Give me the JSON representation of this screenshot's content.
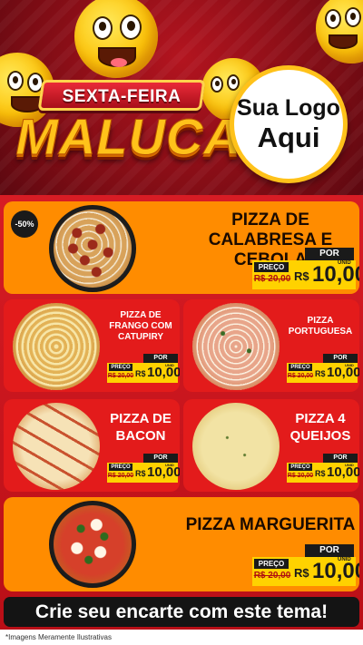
{
  "header": {
    "title_top": "SEXTA-FEIRA",
    "title_main": "MALUCA",
    "logo_line1": "Sua Logo",
    "logo_line2": "Aqui"
  },
  "products": [
    {
      "name": "PIZZA DE CALABRESA E CEBOLA",
      "badge": "-50%",
      "preco_label": "PREÇO",
      "old_price": "R$ 20,00",
      "por_label": "POR",
      "currency": "R$",
      "price": "10,00",
      "unit": "UNID"
    },
    {
      "name": "PIZZA DE FRANGO COM CATUPIRY",
      "preco_label": "PREÇO",
      "old_price": "R$ 20,00",
      "por_label": "POR",
      "currency": "R$",
      "price": "10,00",
      "unit": "UNID"
    },
    {
      "name": "PIZZA PORTUGUESA",
      "preco_label": "PREÇO",
      "old_price": "R$ 20,00",
      "por_label": "POR",
      "currency": "R$",
      "price": "10,00",
      "unit": "UNID"
    },
    {
      "name": "PIZZA DE BACON",
      "preco_label": "PREÇO",
      "old_price": "R$ 20,00",
      "por_label": "POR",
      "currency": "R$",
      "price": "10,00",
      "unit": "UNID"
    },
    {
      "name": "PIZZA 4 QUEIJOS",
      "preco_label": "PREÇO",
      "old_price": "R$ 20,00",
      "por_label": "POR",
      "currency": "R$",
      "price": "10,00",
      "unit": "UNID"
    },
    {
      "name": "PIZZA MARGUERITA",
      "preco_label": "PREÇO",
      "old_price": "R$ 20,00",
      "por_label": "POR",
      "currency": "R$",
      "price": "10,00",
      "unit": "UNID"
    }
  ],
  "cta": "Crie seu encarte com este tema!",
  "footnote": "*Imagens Meramente Ilustrativas",
  "colors": {
    "orange_card": "#ff8c00",
    "red_card": "#e31b1b",
    "price_yellow": "#ffd200",
    "brand_red": "#c8121d"
  }
}
